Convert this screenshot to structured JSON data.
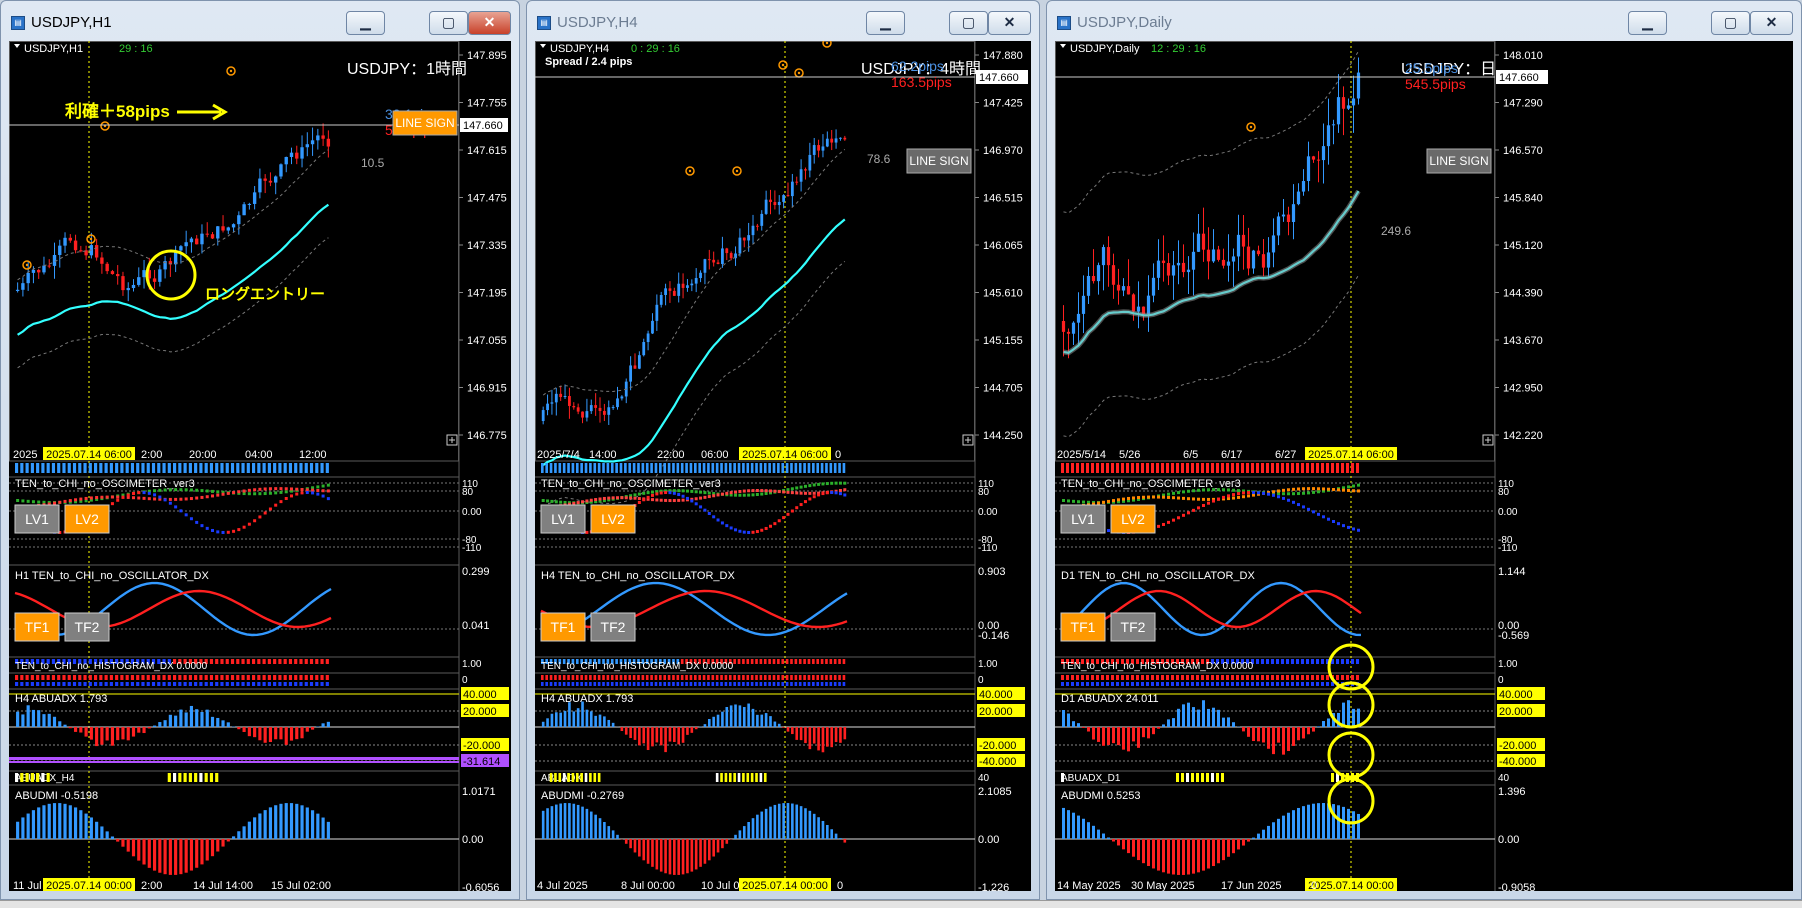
{
  "windows": [
    {
      "title": "USDJPY,H1",
      "active": true,
      "symbol": "USDJPY,H1",
      "countdown": "29 : 16",
      "spread": "",
      "big_label": "USDJPY：1時間",
      "pips_a": "30.1pips",
      "pips_b": "57.0pips",
      "line_sign": "LINE SIGN",
      "atr_value": "10.5",
      "price_current": "147.660",
      "price_ticks": [
        "147.895",
        "147.755",
        "147.615",
        "147.475",
        "147.335",
        "147.195",
        "147.055",
        "146.915",
        "146.775"
      ],
      "time_start": "2025.07.14 06:00",
      "time_ticks": [
        "2025",
        "2:00",
        "20:00",
        "04:00",
        "12:00"
      ],
      "osc_title": "TEN_to_CHI_no_OSCIMETER_ver3",
      "osc_ticks": [
        "110",
        "80",
        "0.00",
        "-80",
        "-110"
      ],
      "lv1": "LV1",
      "lv2": "LV2",
      "osc2_title": "H1 TEN_to_CHI_no_OSCILLATOR_DX",
      "osc2_ticks": [
        "0.299",
        "0.041"
      ],
      "tf1": "TF1",
      "tf2": "TF2",
      "hist_title": "TEN_to_CHI_no_HISTOGRAM_DX 0.0000",
      "hist_ticks": [
        "1.00",
        "0"
      ],
      "adx_title": "H4 ABUADX  1.793",
      "adx_ticks": [
        "40.000",
        "20.000",
        "-20.000",
        "-31.614"
      ],
      "adx2_title": "ABUADX_H4",
      "adx2_ticks": [],
      "dmi_title": "ABUDMI  -0.5198",
      "dmi_ticks": [
        "1.0171",
        "0.00",
        "-0.6056"
      ],
      "bottom_start": "2025.07.14 00:00",
      "bottom_ticks": [
        "11 Jul",
        "2:00",
        "14 Jul 14:00",
        "15 Jul 02:00"
      ],
      "annotation_profit": "利確＋58pips",
      "annotation_entry": "ロングエントリー"
    },
    {
      "title": "USDJPY,H4",
      "active": false,
      "symbol": "USDJPY,H4",
      "countdown": "0 : 29 : 16",
      "spread": "Spread / 2.4 pips",
      "big_label": "USDJPY：4時間",
      "pips_a": "62.2pips",
      "pips_b": "163.5pips",
      "line_sign": "LINE SIGN",
      "atr_value": "78.6",
      "price_current": "147.660",
      "price_ticks": [
        "147.880",
        "147.425",
        "146.970",
        "146.515",
        "146.065",
        "145.610",
        "145.155",
        "144.705",
        "144.250"
      ],
      "time_start": "2025.07.14 06:00",
      "time_ticks": [
        "2025/7/4",
        "14:00",
        "22:00",
        "06:00",
        "0"
      ],
      "osc_title": "TEN_to_CHI_no_OSCIMETER_ver3",
      "osc_ticks": [
        "110",
        "80",
        "0.00",
        "-80",
        "-110"
      ],
      "lv1": "LV1",
      "lv2": "LV2",
      "osc2_title": "H4 TEN_to_CHI_no_OSCILLATOR_DX",
      "osc2_ticks": [
        "0.903",
        "0.00",
        "-0.146"
      ],
      "tf1": "TF1",
      "tf2": "TF2",
      "hist_title": "TEN_to_CHI_no_HISTOGRAM_DX 0.0000",
      "hist_ticks": [
        "1.00",
        "0"
      ],
      "adx_title": "H4 ABUADX  1.793",
      "adx_ticks": [
        "40.000",
        "20.000",
        "-20.000",
        "-40.000"
      ],
      "adx2_title": "ABUADX",
      "adx2_ticks": [
        "40"
      ],
      "dmi_title": "ABUDMI  -0.2769",
      "dmi_ticks": [
        "2.1085",
        "0.00",
        "-1.226"
      ],
      "bottom_start": "2025.07.14 00:00",
      "bottom_ticks": [
        "4 Jul 2025",
        "8 Jul 00:00",
        "10 Jul 0",
        "0"
      ],
      "annotation_profit": "",
      "annotation_entry": ""
    },
    {
      "title": "USDJPY,Daily",
      "active": false,
      "symbol": "USDJPY,Daily",
      "countdown": "12 : 29 : 16",
      "spread": "",
      "big_label": "USDJPY：日",
      "pips_a": "25.5pips",
      "pips_b": "545.5pips",
      "line_sign": "LINE SIGN",
      "atr_value": "249.6",
      "price_current": "147.660",
      "price_ticks": [
        "148.010",
        "147.290",
        "146.570",
        "145.840",
        "145.120",
        "144.390",
        "143.670",
        "142.950",
        "142.220"
      ],
      "time_start": "2025.07.14 06:00",
      "time_ticks": [
        "2025/5/14",
        "5/26",
        "6/5",
        "6/17",
        "6/27"
      ],
      "osc_title": "TEN_to_CHI_no_OSCIMETER_ver3",
      "osc_ticks": [
        "110",
        "80",
        "0.00",
        "-80",
        "-110"
      ],
      "lv1": "LV1",
      "lv2": "LV2",
      "osc2_title": "D1 TEN_to_CHI_no_OSCILLATOR_DX",
      "osc2_ticks": [
        "1.144",
        "0.00",
        "-0.569"
      ],
      "tf1": "TF1",
      "tf2": "TF2",
      "hist_title": "TEN_to_CHI_no_HISTOGRAM_DX 0.0000",
      "hist_ticks": [
        "1.00",
        "0"
      ],
      "adx_title": "D1 ABUADX  24.011",
      "adx_ticks": [
        "40.000",
        "20.000",
        "-20.000",
        "-40.000"
      ],
      "adx2_title": "ABUADX_D1",
      "adx2_ticks": [
        "40"
      ],
      "dmi_title": "ABUDMI  0.5253",
      "dmi_ticks": [
        "1.396",
        "0.00",
        "-0.9058"
      ],
      "bottom_start": "2025.07.14 00:00",
      "bottom_ticks": [
        "14 May 2025",
        "30 May 2025",
        "17 Jun 2025",
        "0"
      ],
      "annotation_profit": "",
      "annotation_entry": ""
    }
  ],
  "colors": {
    "bull": "#3399ff",
    "bear": "#ff2020",
    "ma": "#33ffff",
    "orange": "#ff9900",
    "yellow": "#ffff00",
    "purple": "#b050ff",
    "green": "#33cc33",
    "blue": "#1a3cff",
    "lvgray": "#808080"
  },
  "icons": [
    "app-window-icon",
    "minimize-icon",
    "maximize-icon",
    "close-icon",
    "expand-icon",
    "yellow-highlight-circle"
  ]
}
